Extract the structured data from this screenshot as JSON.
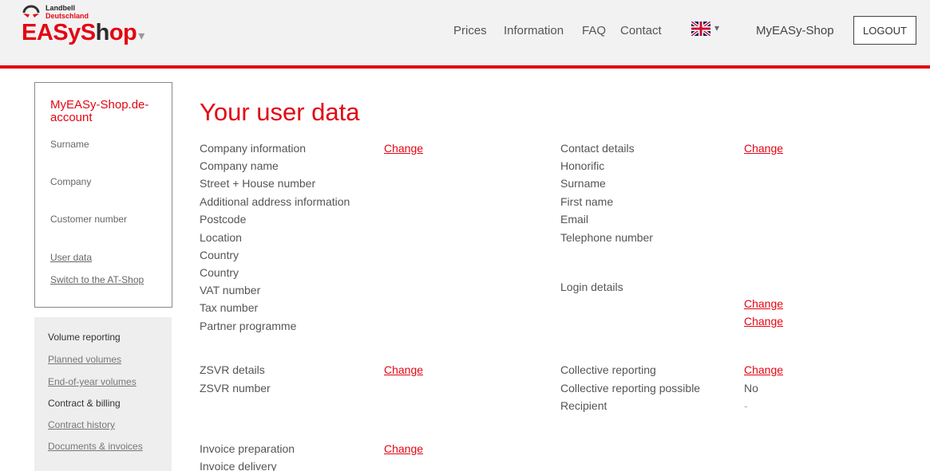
{
  "header": {
    "logo_small_line1": "Landbell",
    "logo_small_line2": "Deutschland",
    "logo_main_a": "EASyS",
    "logo_main_b": "h",
    "logo_main_c": "op",
    "logo_caret": "▾",
    "nav": [
      "Prices",
      "Information",
      "FAQ",
      "Contact"
    ],
    "language_caret": "▾",
    "myeasy": "MyEASy-Shop",
    "logout": "LOGOUT",
    "accent": "#e30613"
  },
  "sidebar": {
    "title": "MyEASy-Shop.de-account",
    "labels": [
      "Surname",
      "Company",
      "Customer number"
    ],
    "links": [
      "User data",
      "Switch to the AT-Shop"
    ]
  },
  "sidebar2": {
    "items": [
      {
        "label": "Volume reporting",
        "type": "head"
      },
      {
        "label": "Planned volumes",
        "type": "link"
      },
      {
        "label": "End-of-year volumes",
        "type": "link"
      },
      {
        "label": "Contract & billing",
        "type": "head"
      },
      {
        "label": "Contract history",
        "type": "link"
      },
      {
        "label": "Documents & invoices",
        "type": "link"
      }
    ]
  },
  "main": {
    "title": "Your user data",
    "change_label": "Change",
    "company": {
      "header": "Company information",
      "fields": [
        "Company name",
        "Street + House number",
        "Additional address information",
        "Postcode",
        "Location",
        "Country",
        "Country",
        "VAT number",
        "Tax number",
        "Partner programme"
      ]
    },
    "contact": {
      "header": "Contact details",
      "fields": [
        "Honorific",
        "Surname",
        "First name",
        "Email",
        "Telephone number"
      ]
    },
    "login": {
      "header": "Login details"
    },
    "zsvr": {
      "header": "ZSVR details",
      "fields": [
        "ZSVR number"
      ]
    },
    "collective": {
      "header": "Collective reporting",
      "fields": [
        {
          "label": "Collective reporting possible",
          "value": "No"
        },
        {
          "label": "Recipient",
          "value": "-"
        }
      ]
    },
    "invoice": {
      "header": "Invoice preparation",
      "fields": [
        "Invoice delivery"
      ]
    }
  }
}
